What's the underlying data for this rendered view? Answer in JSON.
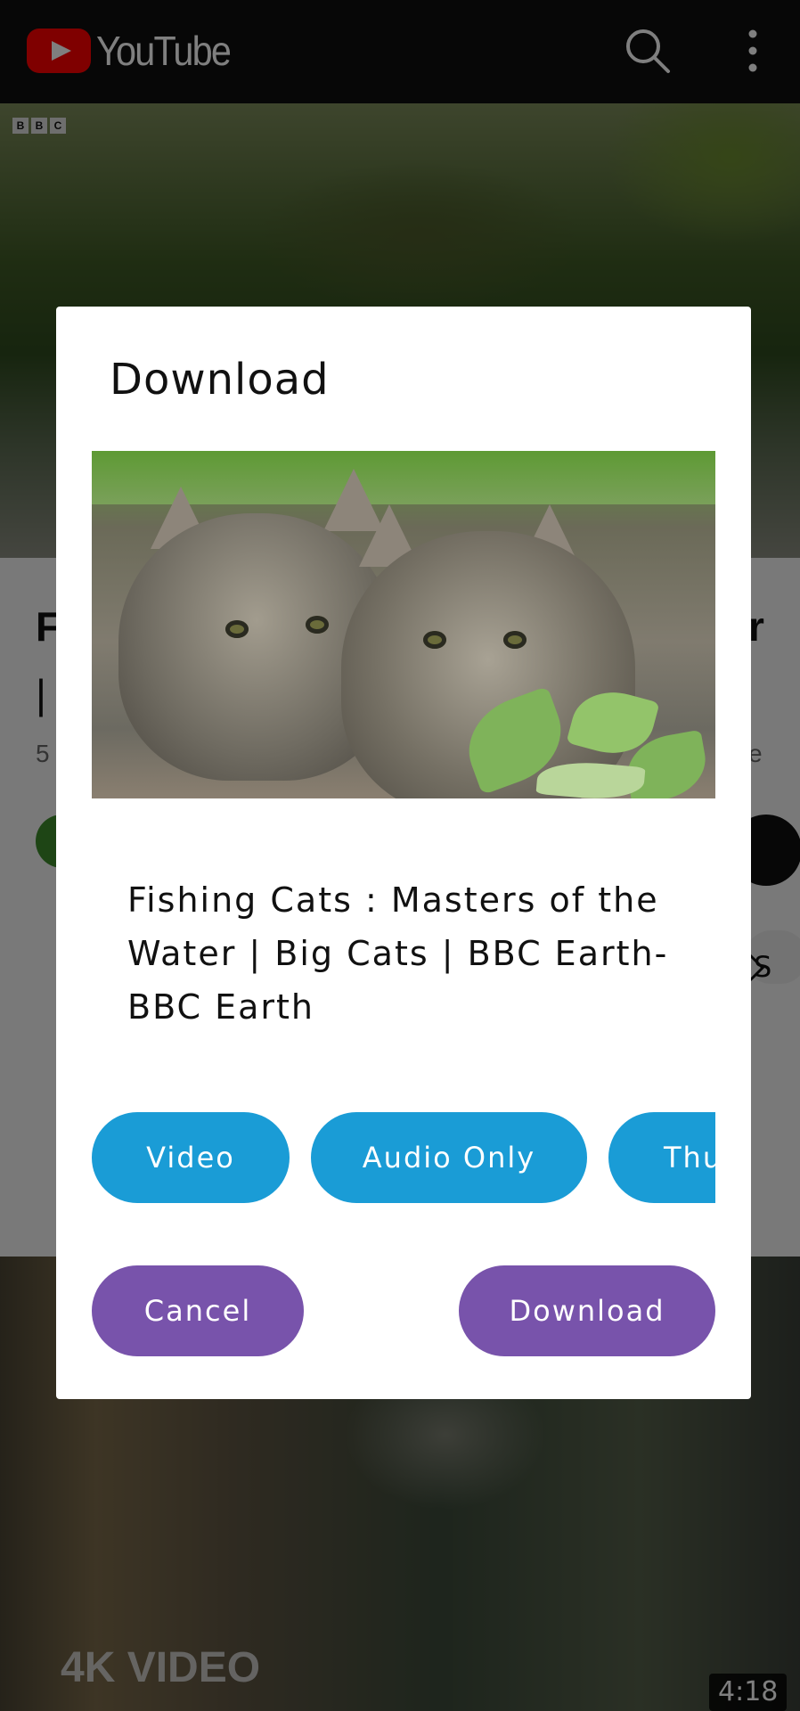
{
  "app": {
    "logo_text": "YouTube"
  },
  "background": {
    "channel_badge": [
      "B",
      "B",
      "C"
    ],
    "title_fragment_left": "F",
    "title_fragment_right": "r",
    "title_pipe": "|",
    "meta_fragment_left": "5",
    "meta_fragment_right": "e",
    "chip_fragment": "S",
    "next_video_badge": "4K VIDEO",
    "next_video_duration": "4:18"
  },
  "dialog": {
    "title": "Download",
    "video_title": "Fishing Cats : Masters of the Water | Big Cats | BBC Earth-BBC Earth",
    "options": {
      "video": "Video",
      "audio_only": "Audio Only",
      "thumbnail": "Thu"
    },
    "actions": {
      "cancel": "Cancel",
      "download": "Download"
    }
  },
  "colors": {
    "option_pill": "#1a9cd6",
    "action_pill": "#7853ab",
    "youtube_red": "#ff0000"
  },
  "icons": [
    "youtube-play-icon",
    "search-icon",
    "more-vertical-icon",
    "chevron-right-icon"
  ]
}
